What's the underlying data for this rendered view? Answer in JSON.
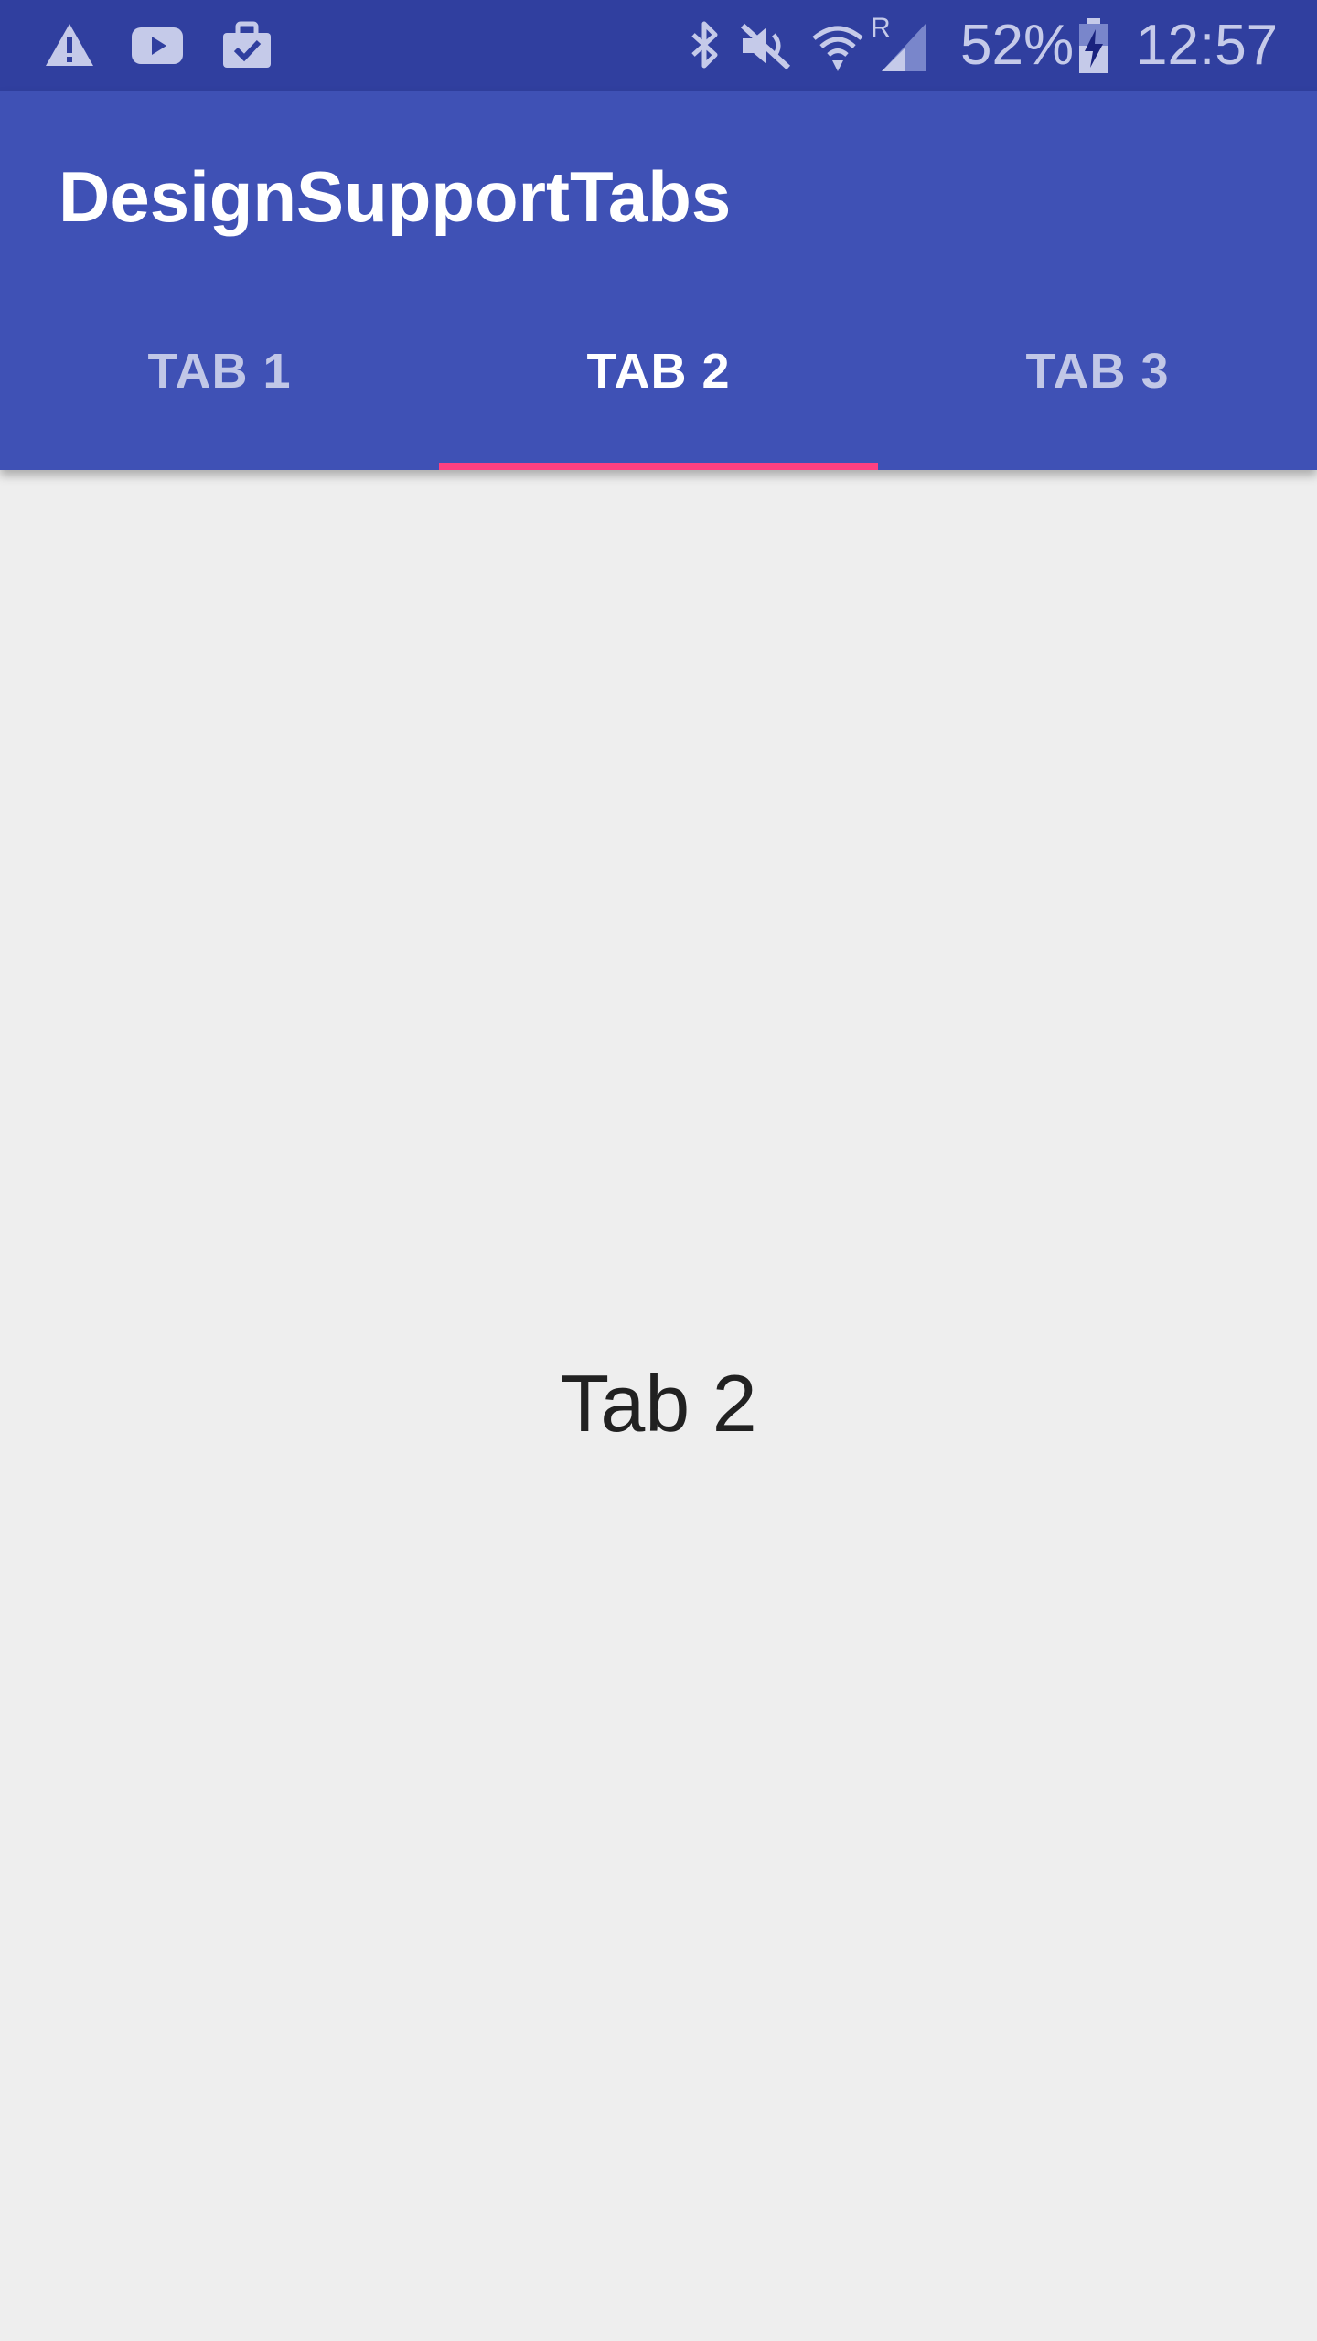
{
  "status_bar": {
    "left_icons": [
      "warning-icon",
      "youtube-icon",
      "work-briefcase-icon"
    ],
    "right_icons": [
      "bluetooth-icon",
      "mute-icon",
      "wifi-icon",
      "signal-roaming-icon",
      "battery-charging-icon"
    ],
    "battery_percent": "52%",
    "time": "12:57",
    "roaming_letter": "R",
    "colors": {
      "background": "#303f9f",
      "icon": "#c5cae9"
    }
  },
  "app_bar": {
    "title": "DesignSupportTabs",
    "background": "#3f51b5"
  },
  "tabs": {
    "items": [
      {
        "label": "TAB 1",
        "selected": false
      },
      {
        "label": "TAB 2",
        "selected": true
      },
      {
        "label": "TAB 3",
        "selected": false
      }
    ],
    "indicator_color": "#ff4081"
  },
  "content": {
    "label": "Tab 2"
  }
}
